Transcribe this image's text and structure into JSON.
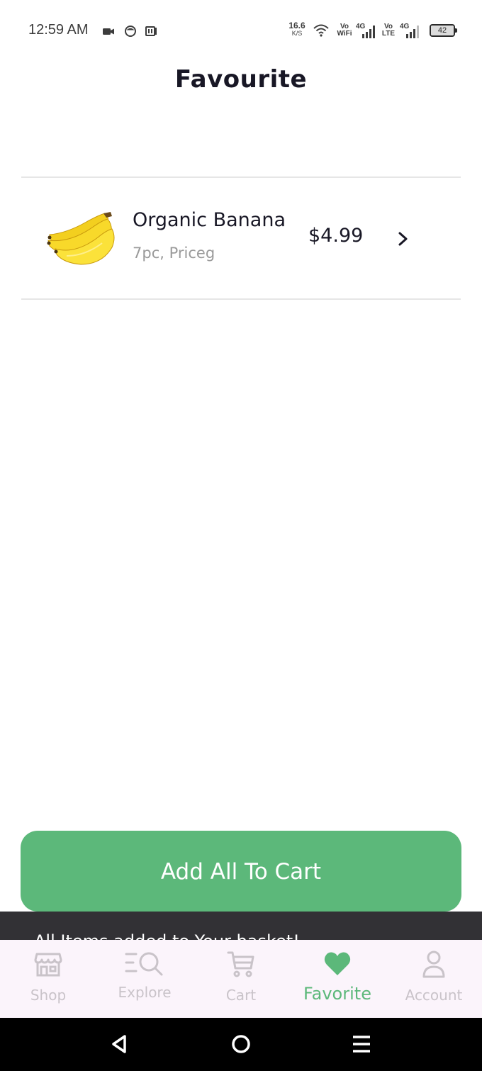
{
  "status_bar": {
    "time": "12:59 AM",
    "net_speed_value": "16.6",
    "net_speed_unit": "K/S",
    "vowifi_top": "Vo",
    "vowifi_bottom": "WiFi",
    "sim1_type": "4G",
    "volte_top": "Vo",
    "volte_bottom": "LTE",
    "sim2_type": "4G",
    "battery_level": "42"
  },
  "page": {
    "title": "Favourite"
  },
  "favourites": [
    {
      "name": "Organic Banana",
      "detail": "7pc, Priceg",
      "price": "$4.99",
      "image_icon": "banana-image"
    }
  ],
  "actions": {
    "add_all_label": "Add All To Cart"
  },
  "snackbar": {
    "message": "All Items added to Your basket!"
  },
  "bottom_nav": {
    "items": [
      {
        "label": "Shop",
        "icon": "store-icon",
        "active": false
      },
      {
        "label": "Explore",
        "icon": "explore-icon",
        "active": false
      },
      {
        "label": "Cart",
        "icon": "cart-icon",
        "active": false
      },
      {
        "label": "Favorite",
        "icon": "heart-icon",
        "active": true
      },
      {
        "label": "Account",
        "icon": "account-icon",
        "active": false
      }
    ]
  },
  "colors": {
    "accent": "#5cb87a",
    "nav_background": "#fbf4fb",
    "nav_inactive": "#c9c3c9",
    "snackbar": "#323135"
  }
}
